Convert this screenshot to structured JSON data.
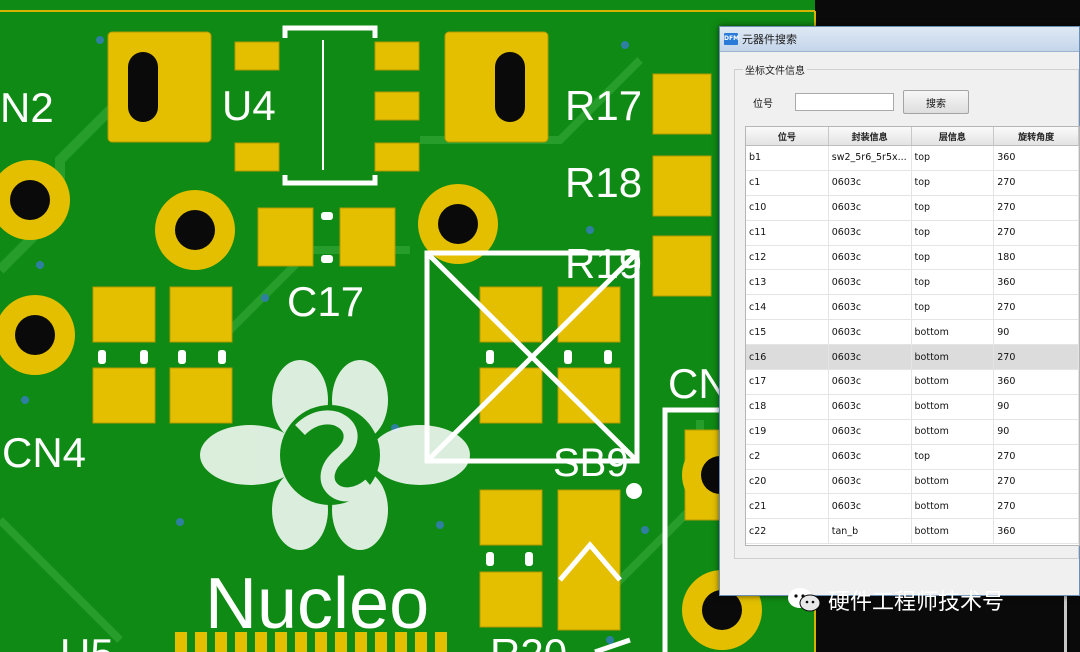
{
  "pcb": {
    "labels": {
      "n2": "N2",
      "u4": "U4",
      "r17": "R17",
      "r18": "R18",
      "r19": "R19",
      "c17": "C17",
      "cn4": "CN4",
      "cn_partial": "CN",
      "sb9": "SB9",
      "nucleo": "Nucleo",
      "u5_partial": "U5",
      "r20_partial": "R20"
    },
    "colors": {
      "board": "#0f8a14",
      "pad": "#e3bf00",
      "silk": "#ffffff",
      "via": "#2e7fa0"
    }
  },
  "window": {
    "title": "元器件搜索",
    "icon_text": "DFM",
    "group_title": "坐标文件信息",
    "search_label": "位号",
    "search_value": "",
    "search_button": "搜索",
    "columns": [
      "位号",
      "封装信息",
      "层信息",
      "旋转角度"
    ],
    "rows": [
      [
        "b1",
        "sw2_5r6_5r5x...",
        "top",
        "360"
      ],
      [
        "c1",
        "0603c",
        "top",
        "270"
      ],
      [
        "c10",
        "0603c",
        "top",
        "270"
      ],
      [
        "c11",
        "0603c",
        "top",
        "270"
      ],
      [
        "c12",
        "0603c",
        "top",
        "180"
      ],
      [
        "c13",
        "0603c",
        "top",
        "360"
      ],
      [
        "c14",
        "0603c",
        "top",
        "270"
      ],
      [
        "c15",
        "0603c",
        "bottom",
        "90"
      ],
      [
        "c16",
        "0603c",
        "bottom",
        "270"
      ],
      [
        "c17",
        "0603c",
        "bottom",
        "360"
      ],
      [
        "c18",
        "0603c",
        "bottom",
        "90"
      ],
      [
        "c19",
        "0603c",
        "bottom",
        "90"
      ],
      [
        "c2",
        "0603c",
        "top",
        "270"
      ],
      [
        "c20",
        "0603c",
        "bottom",
        "270"
      ],
      [
        "c21",
        "0603c",
        "bottom",
        "270"
      ],
      [
        "c22",
        "tan_b",
        "bottom",
        "360"
      ]
    ],
    "selected_row": 8
  },
  "watermark": {
    "text": "硬件工程师技术号",
    "icon": "wechat-icon"
  }
}
